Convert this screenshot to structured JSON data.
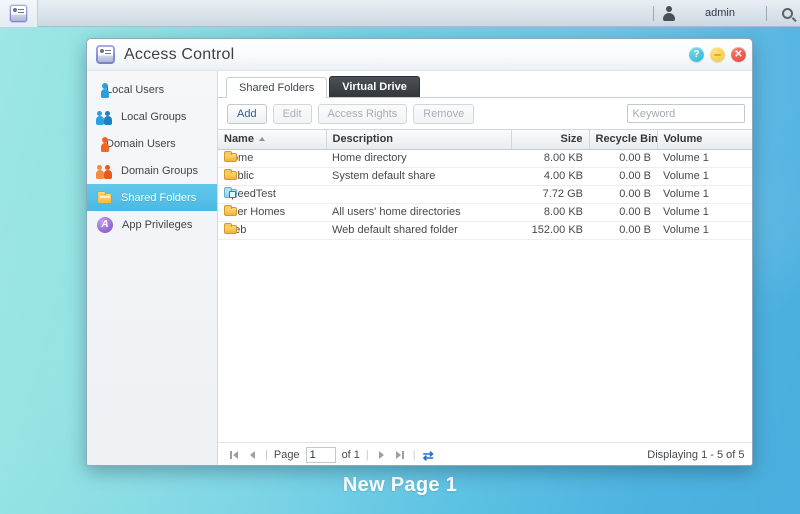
{
  "taskbar": {
    "app_icon": "id-card-icon",
    "user_icon": "user-icon",
    "username": "admin",
    "search_icon": "search-icon"
  },
  "window": {
    "icon": "access-control-icon",
    "title": "Access Control",
    "buttons": {
      "help": "?",
      "minimize": "",
      "close": "✕"
    }
  },
  "sidebar": {
    "items": [
      {
        "label": "Local Users",
        "icon": "user-blue-icon",
        "selected": false
      },
      {
        "label": "Local Groups",
        "icon": "users-blue-icon",
        "selected": false
      },
      {
        "label": "Domain Users",
        "icon": "user-orange-icon",
        "selected": false
      },
      {
        "label": "Domain Groups",
        "icon": "users-orange-icon",
        "selected": false
      },
      {
        "label": "Shared Folders",
        "icon": "folder-icon",
        "selected": true
      },
      {
        "label": "App Privileges",
        "icon": "app-privileges-icon",
        "selected": false
      }
    ]
  },
  "main": {
    "tabs": [
      {
        "label": "Shared Folders",
        "active": true
      },
      {
        "label": "Virtual Drive",
        "active": false
      }
    ],
    "toolbar": {
      "add_label": "Add",
      "edit_label": "Edit",
      "access_rights_label": "Access Rights",
      "remove_label": "Remove",
      "keyword_placeholder": "Keyword",
      "keyword_value": ""
    },
    "grid": {
      "columns": [
        "Name",
        "Description",
        "Size",
        "Recycle Bin Siz",
        "Volume"
      ],
      "sort_column": "Name",
      "sort_direction": "asc",
      "rows": [
        {
          "icon": "folder-icon",
          "name": "Home",
          "description": "Home directory",
          "size": "8.00 KB",
          "recycle_bin_size": "0.00 B",
          "volume": "Volume 1"
        },
        {
          "icon": "folder-icon",
          "name": "Public",
          "description": "System default share",
          "size": "4.00 KB",
          "recycle_bin_size": "0.00 B",
          "volume": "Volume 1"
        },
        {
          "icon": "folder-locked-icon",
          "name": "SpeedTest",
          "description": "",
          "size": "7.72 GB",
          "recycle_bin_size": "0.00 B",
          "volume": "Volume 1"
        },
        {
          "icon": "folder-icon",
          "name": "User Homes",
          "description": "All users' home directories",
          "size": "8.00 KB",
          "recycle_bin_size": "0.00 B",
          "volume": "Volume 1"
        },
        {
          "icon": "folder-icon",
          "name": "Web",
          "description": "Web default shared folder",
          "size": "152.00 KB",
          "recycle_bin_size": "0.00 B",
          "volume": "Volume 1"
        }
      ]
    },
    "pager": {
      "first_icon": "first-page-icon",
      "prev_icon": "prev-page-icon",
      "page_label": "Page",
      "page_value": "1",
      "of_label": "of 1",
      "next_icon": "next-page-icon",
      "last_icon": "last-page-icon",
      "refresh_icon": "refresh-icon",
      "status": "Displaying 1 - 5 of 5"
    }
  },
  "desktop": {
    "caption": "New Page 1"
  },
  "colors": {
    "accent": "#4bb9e4",
    "tab_inactive_bg": "#33373b",
    "folder": "#f0b53a",
    "link": "#2b5f9e"
  }
}
